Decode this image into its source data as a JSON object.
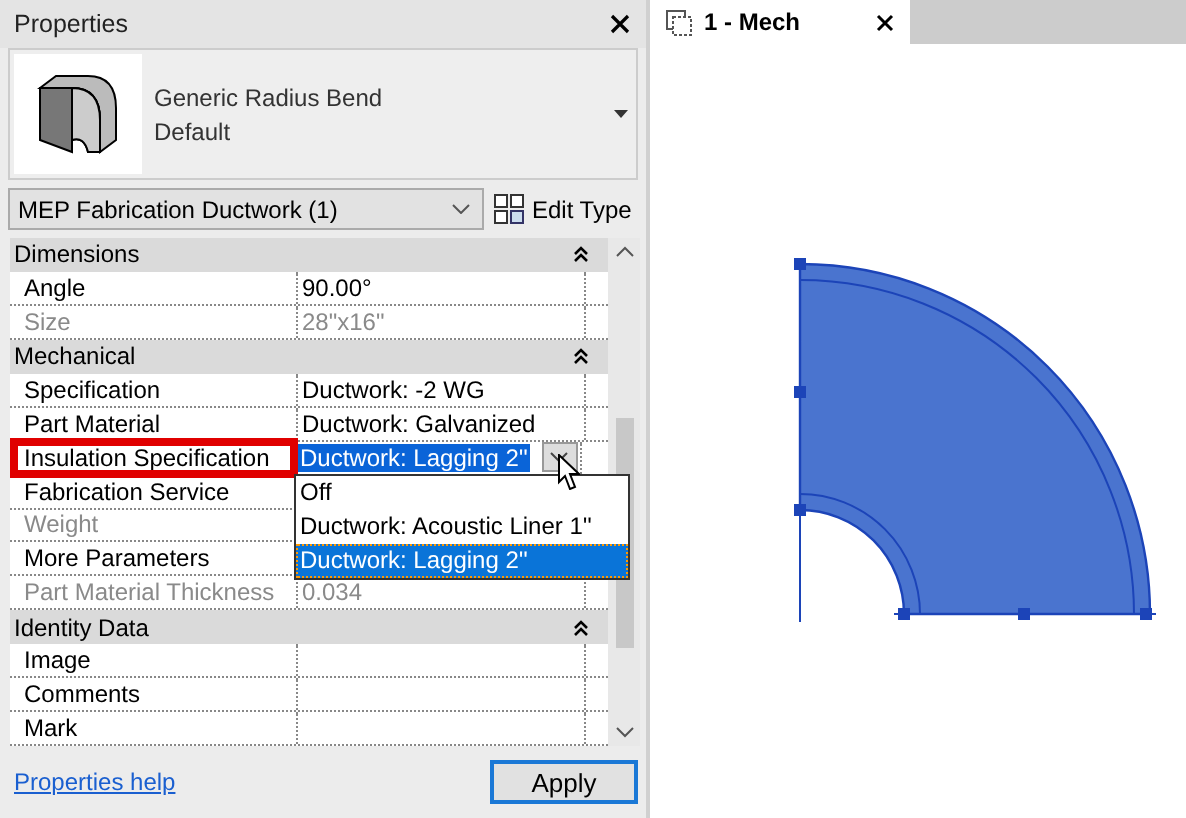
{
  "properties_panel": {
    "title": "Properties",
    "type_selector": {
      "name": "Generic Radius Bend",
      "type": "Default"
    },
    "filter": {
      "value": "MEP Fabrication Ductwork (1)"
    },
    "edit_type_button": "Edit Type",
    "groups": [
      {
        "name": "Dimensions",
        "expanded": true,
        "rows": [
          {
            "name": "Angle",
            "value": "90.00°",
            "disabled": false,
            "highlighted": false,
            "kind": "text"
          },
          {
            "name": "Size",
            "value": "28\"x16\"",
            "disabled": true,
            "highlighted": false,
            "kind": "text"
          }
        ]
      },
      {
        "name": "Mechanical",
        "expanded": true,
        "rows": [
          {
            "name": "Specification",
            "value": "Ductwork: -2 WG",
            "disabled": false,
            "highlighted": false,
            "kind": "text"
          },
          {
            "name": "Part Material",
            "value": "Ductwork: Galvanized",
            "disabled": false,
            "highlighted": false,
            "kind": "text"
          },
          {
            "name": "Insulation Specification",
            "value": "Ductwork: Lagging 2''",
            "disabled": false,
            "highlighted": true,
            "kind": "dropdown",
            "options": [
              {
                "label": "Off",
                "selected": false
              },
              {
                "label": "Ductwork: Acoustic Liner 1''",
                "selected": false
              },
              {
                "label": "Ductwork: Lagging 2''",
                "selected": true
              }
            ]
          },
          {
            "name": "Fabrication Service",
            "value": "",
            "disabled": false,
            "highlighted": false,
            "kind": "text"
          },
          {
            "name": "Weight",
            "value": "",
            "disabled": true,
            "highlighted": false,
            "kind": "text"
          },
          {
            "name": "More Parameters",
            "value": "",
            "disabled": false,
            "highlighted": false,
            "kind": "text"
          },
          {
            "name": "Part Material Thickness",
            "value": "0.034",
            "disabled": true,
            "highlighted": false,
            "kind": "text"
          }
        ]
      },
      {
        "name": "Identity Data",
        "expanded": true,
        "rows": [
          {
            "name": "Image",
            "value": "",
            "disabled": false,
            "highlighted": false,
            "kind": "text"
          },
          {
            "name": "Comments",
            "value": "",
            "disabled": false,
            "highlighted": false,
            "kind": "text"
          },
          {
            "name": "Mark",
            "value": "",
            "disabled": false,
            "highlighted": false,
            "kind": "text"
          }
        ]
      }
    ],
    "help_link": "Properties help",
    "apply_button": "Apply"
  },
  "view_tabs": [
    {
      "label": "1 - Mech",
      "selected": true
    }
  ]
}
